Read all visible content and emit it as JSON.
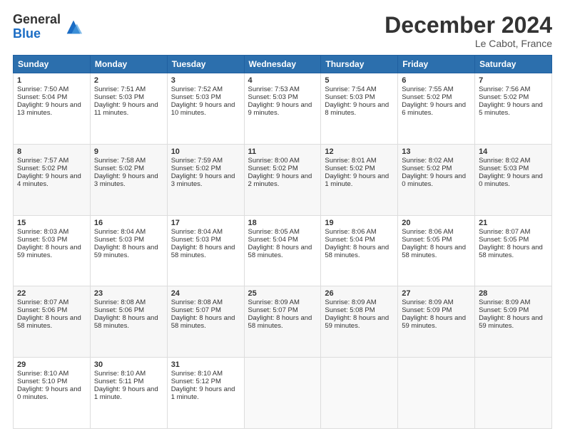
{
  "logo": {
    "general": "General",
    "blue": "Blue"
  },
  "title": "December 2024",
  "location": "Le Cabot, France",
  "days_of_week": [
    "Sunday",
    "Monday",
    "Tuesday",
    "Wednesday",
    "Thursday",
    "Friday",
    "Saturday"
  ],
  "weeks": [
    [
      {
        "day": "1",
        "sunrise": "Sunrise: 7:50 AM",
        "sunset": "Sunset: 5:04 PM",
        "daylight": "Daylight: 9 hours and 13 minutes."
      },
      {
        "day": "2",
        "sunrise": "Sunrise: 7:51 AM",
        "sunset": "Sunset: 5:03 PM",
        "daylight": "Daylight: 9 hours and 11 minutes."
      },
      {
        "day": "3",
        "sunrise": "Sunrise: 7:52 AM",
        "sunset": "Sunset: 5:03 PM",
        "daylight": "Daylight: 9 hours and 10 minutes."
      },
      {
        "day": "4",
        "sunrise": "Sunrise: 7:53 AM",
        "sunset": "Sunset: 5:03 PM",
        "daylight": "Daylight: 9 hours and 9 minutes."
      },
      {
        "day": "5",
        "sunrise": "Sunrise: 7:54 AM",
        "sunset": "Sunset: 5:03 PM",
        "daylight": "Daylight: 9 hours and 8 minutes."
      },
      {
        "day": "6",
        "sunrise": "Sunrise: 7:55 AM",
        "sunset": "Sunset: 5:02 PM",
        "daylight": "Daylight: 9 hours and 6 minutes."
      },
      {
        "day": "7",
        "sunrise": "Sunrise: 7:56 AM",
        "sunset": "Sunset: 5:02 PM",
        "daylight": "Daylight: 9 hours and 5 minutes."
      }
    ],
    [
      {
        "day": "8",
        "sunrise": "Sunrise: 7:57 AM",
        "sunset": "Sunset: 5:02 PM",
        "daylight": "Daylight: 9 hours and 4 minutes."
      },
      {
        "day": "9",
        "sunrise": "Sunrise: 7:58 AM",
        "sunset": "Sunset: 5:02 PM",
        "daylight": "Daylight: 9 hours and 3 minutes."
      },
      {
        "day": "10",
        "sunrise": "Sunrise: 7:59 AM",
        "sunset": "Sunset: 5:02 PM",
        "daylight": "Daylight: 9 hours and 3 minutes."
      },
      {
        "day": "11",
        "sunrise": "Sunrise: 8:00 AM",
        "sunset": "Sunset: 5:02 PM",
        "daylight": "Daylight: 9 hours and 2 minutes."
      },
      {
        "day": "12",
        "sunrise": "Sunrise: 8:01 AM",
        "sunset": "Sunset: 5:02 PM",
        "daylight": "Daylight: 9 hours and 1 minute."
      },
      {
        "day": "13",
        "sunrise": "Sunrise: 8:02 AM",
        "sunset": "Sunset: 5:02 PM",
        "daylight": "Daylight: 9 hours and 0 minutes."
      },
      {
        "day": "14",
        "sunrise": "Sunrise: 8:02 AM",
        "sunset": "Sunset: 5:03 PM",
        "daylight": "Daylight: 9 hours and 0 minutes."
      }
    ],
    [
      {
        "day": "15",
        "sunrise": "Sunrise: 8:03 AM",
        "sunset": "Sunset: 5:03 PM",
        "daylight": "Daylight: 8 hours and 59 minutes."
      },
      {
        "day": "16",
        "sunrise": "Sunrise: 8:04 AM",
        "sunset": "Sunset: 5:03 PM",
        "daylight": "Daylight: 8 hours and 59 minutes."
      },
      {
        "day": "17",
        "sunrise": "Sunrise: 8:04 AM",
        "sunset": "Sunset: 5:03 PM",
        "daylight": "Daylight: 8 hours and 58 minutes."
      },
      {
        "day": "18",
        "sunrise": "Sunrise: 8:05 AM",
        "sunset": "Sunset: 5:04 PM",
        "daylight": "Daylight: 8 hours and 58 minutes."
      },
      {
        "day": "19",
        "sunrise": "Sunrise: 8:06 AM",
        "sunset": "Sunset: 5:04 PM",
        "daylight": "Daylight: 8 hours and 58 minutes."
      },
      {
        "day": "20",
        "sunrise": "Sunrise: 8:06 AM",
        "sunset": "Sunset: 5:05 PM",
        "daylight": "Daylight: 8 hours and 58 minutes."
      },
      {
        "day": "21",
        "sunrise": "Sunrise: 8:07 AM",
        "sunset": "Sunset: 5:05 PM",
        "daylight": "Daylight: 8 hours and 58 minutes."
      }
    ],
    [
      {
        "day": "22",
        "sunrise": "Sunrise: 8:07 AM",
        "sunset": "Sunset: 5:06 PM",
        "daylight": "Daylight: 8 hours and 58 minutes."
      },
      {
        "day": "23",
        "sunrise": "Sunrise: 8:08 AM",
        "sunset": "Sunset: 5:06 PM",
        "daylight": "Daylight: 8 hours and 58 minutes."
      },
      {
        "day": "24",
        "sunrise": "Sunrise: 8:08 AM",
        "sunset": "Sunset: 5:07 PM",
        "daylight": "Daylight: 8 hours and 58 minutes."
      },
      {
        "day": "25",
        "sunrise": "Sunrise: 8:09 AM",
        "sunset": "Sunset: 5:07 PM",
        "daylight": "Daylight: 8 hours and 58 minutes."
      },
      {
        "day": "26",
        "sunrise": "Sunrise: 8:09 AM",
        "sunset": "Sunset: 5:08 PM",
        "daylight": "Daylight: 8 hours and 59 minutes."
      },
      {
        "day": "27",
        "sunrise": "Sunrise: 8:09 AM",
        "sunset": "Sunset: 5:09 PM",
        "daylight": "Daylight: 8 hours and 59 minutes."
      },
      {
        "day": "28",
        "sunrise": "Sunrise: 8:09 AM",
        "sunset": "Sunset: 5:09 PM",
        "daylight": "Daylight: 8 hours and 59 minutes."
      }
    ],
    [
      {
        "day": "29",
        "sunrise": "Sunrise: 8:10 AM",
        "sunset": "Sunset: 5:10 PM",
        "daylight": "Daylight: 9 hours and 0 minutes."
      },
      {
        "day": "30",
        "sunrise": "Sunrise: 8:10 AM",
        "sunset": "Sunset: 5:11 PM",
        "daylight": "Daylight: 9 hours and 1 minute."
      },
      {
        "day": "31",
        "sunrise": "Sunrise: 8:10 AM",
        "sunset": "Sunset: 5:12 PM",
        "daylight": "Daylight: 9 hours and 1 minute."
      },
      null,
      null,
      null,
      null
    ]
  ]
}
